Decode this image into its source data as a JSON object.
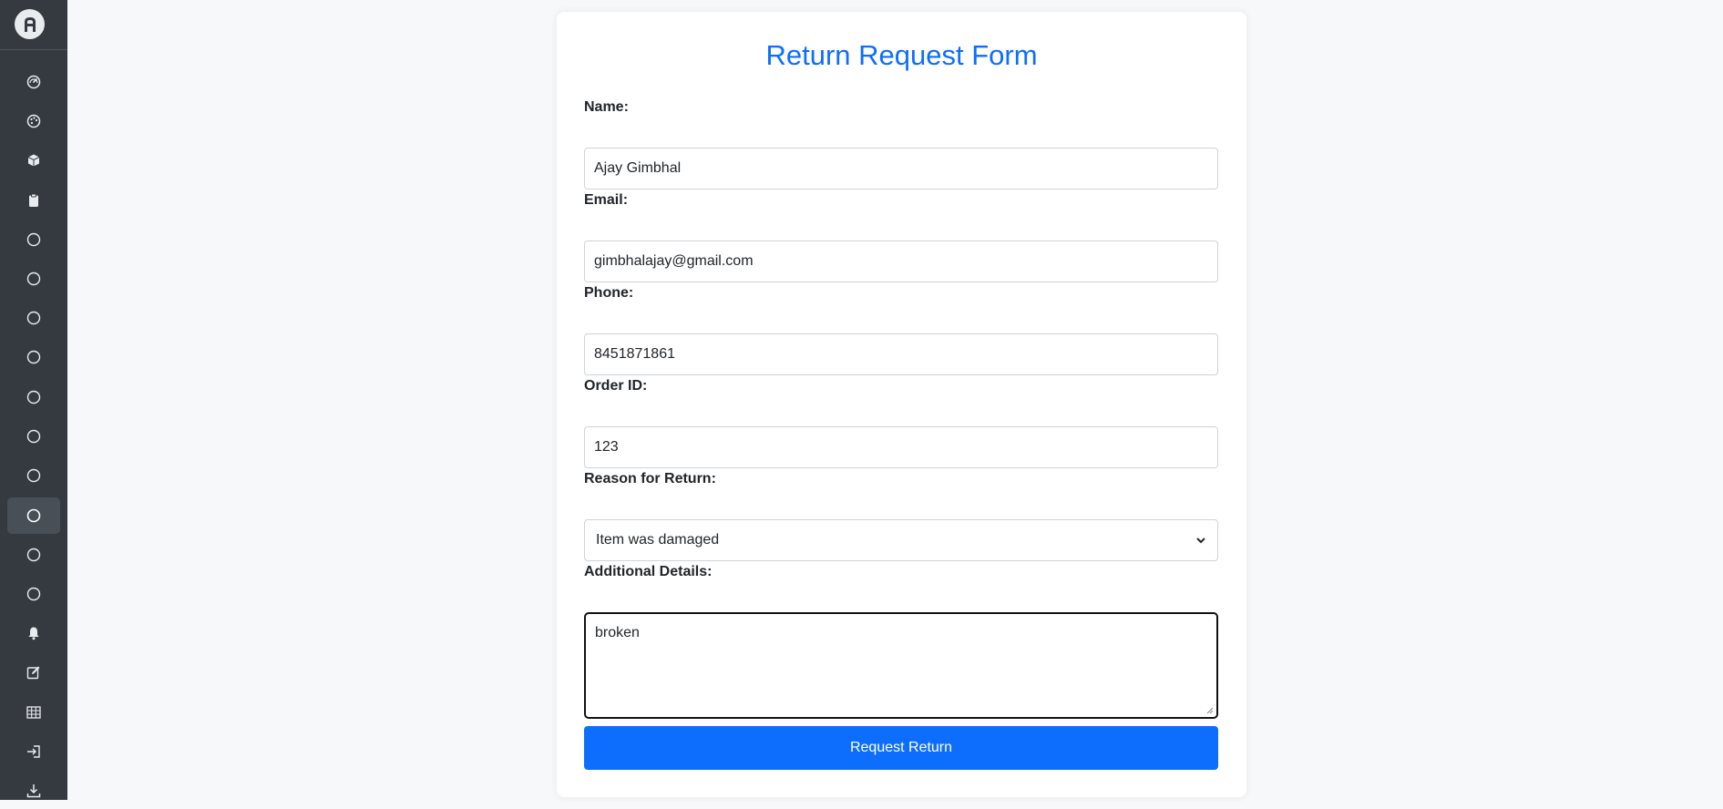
{
  "sidebar": {
    "logo_icon": "app-logo-icon",
    "items": [
      {
        "icon": "dashboard-gauge-icon",
        "active": false
      },
      {
        "icon": "palette-icon",
        "active": false
      },
      {
        "icon": "box-icon",
        "active": false
      },
      {
        "icon": "clipboard-icon",
        "active": false
      },
      {
        "icon": "circle-icon",
        "active": false
      },
      {
        "icon": "circle-icon",
        "active": false
      },
      {
        "icon": "circle-icon",
        "active": false
      },
      {
        "icon": "circle-icon",
        "active": false
      },
      {
        "icon": "circle-icon",
        "active": false
      },
      {
        "icon": "circle-icon",
        "active": false
      },
      {
        "icon": "circle-icon",
        "active": false
      },
      {
        "icon": "circle-icon",
        "active": true
      },
      {
        "icon": "circle-icon",
        "active": false
      },
      {
        "icon": "circle-icon",
        "active": false
      },
      {
        "icon": "bell-icon",
        "active": false
      },
      {
        "icon": "edit-icon",
        "active": false
      },
      {
        "icon": "table-icon",
        "active": false
      },
      {
        "icon": "sign-in-icon",
        "active": false
      },
      {
        "icon": "download-icon",
        "active": false
      }
    ]
  },
  "form": {
    "title": "Return Request Form",
    "name_label": "Name:",
    "name_value": "Ajay Gimbhal",
    "email_label": "Email:",
    "email_value": "gimbhalajay@gmail.com",
    "phone_label": "Phone:",
    "phone_value": "8451871861",
    "order_label": "Order ID:",
    "order_value": "123",
    "reason_label": "Reason for Return:",
    "reason_value": "Item was damaged",
    "details_label": "Additional Details:",
    "details_value": "broken",
    "submit_label": "Request Return"
  },
  "colors": {
    "sidebar_bg": "#343a40",
    "accent": "#0d6efd",
    "page_bg": "#f7f8fa"
  }
}
